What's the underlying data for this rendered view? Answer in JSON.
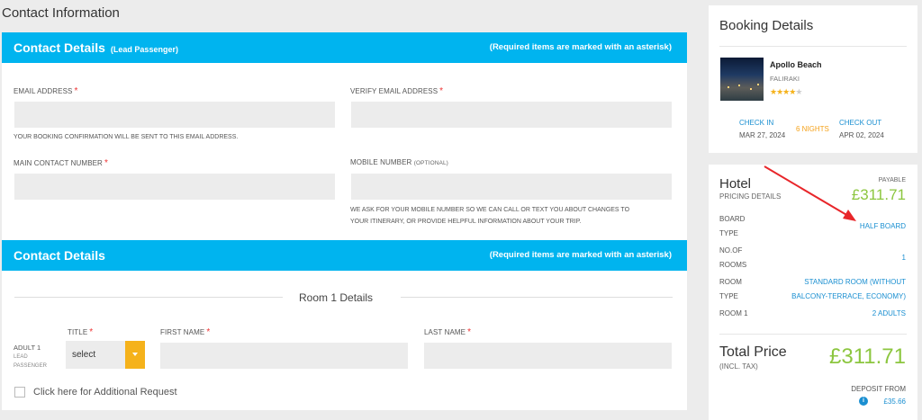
{
  "page_title": "Contact Information",
  "contact_section": {
    "title": "Contact Details",
    "subtitle": "(Lead Passenger)",
    "note": "(Required items are marked with an asterisk)",
    "email_label": "EMAIL ADDRESS",
    "email_value": "",
    "email_hint": "YOUR BOOKING CONFIRMATION WILL BE SENT TO THIS EMAIL ADDRESS.",
    "verify_email_label": "VERIFY EMAIL ADDRESS",
    "verify_email_value": "",
    "main_contact_label": "MAIN CONTACT NUMBER",
    "main_contact_value": "",
    "mobile_label": "MOBILE NUMBER",
    "mobile_optional": "(OPTIONAL)",
    "mobile_value": "",
    "mobile_hint_line1": "WE ASK FOR YOUR MOBILE NUMBER SO WE CAN CALL OR TEXT YOU ABOUT CHANGES TO",
    "mobile_hint_line2": "YOUR ITINERARY, OR PROVIDE HELPFUL INFORMATION ABOUT YOUR TRIP.",
    "required_mark": "*"
  },
  "room_section": {
    "title": "Contact Details",
    "note": "(Required items are marked with an asterisk)",
    "room_title": "Room 1 Details",
    "title_label": "TITLE",
    "first_name_label": "FIRST NAME",
    "last_name_label": "LAST NAME",
    "adult_label": "ADULT 1",
    "lead_line1": "LEAD",
    "lead_line2": "PASSENGER",
    "title_select_value": "select",
    "first_name_value": "",
    "last_name_value": "",
    "additional_request_label": "Click here for Additional Request"
  },
  "booking": {
    "title": "Booking Details",
    "hotel_name": "Apollo Beach",
    "hotel_location": "FALIRAKI",
    "rating_of_5": 4,
    "star_glyph": "★",
    "check_in_label": "CHECK IN",
    "check_in_date": "MAR 27, 2024",
    "nights": "6 NIGHTS",
    "check_out_label": "CHECK OUT",
    "check_out_date": "APR 02, 2024"
  },
  "pricing": {
    "title": "Hotel",
    "subtitle": "PRICING DETAILS",
    "payable_label": "PAYABLE",
    "payable_amount": "£311.71",
    "board_type_label_1": "BOARD",
    "board_type_label_2": "TYPE",
    "board_type_value": "HALF BOARD",
    "rooms_label_1": "NO.OF",
    "rooms_label_2": "ROOMS",
    "rooms_value": "1",
    "room_type_label_1": "ROOM",
    "room_type_label_2": "TYPE",
    "room_type_value_1": "STANDARD ROOM (WITHOUT",
    "room_type_value_2": "BALCONY-TERRACE, ECONOMY)",
    "room1_label": "ROOM 1",
    "room1_value": "2 ADULTS",
    "total_title": "Total Price",
    "total_sub": "(INCL. TAX)",
    "total_amount": "£311.71",
    "deposit_label": "DEPOSIT FROM",
    "deposit_amount": "£35.66",
    "info_glyph": "i"
  },
  "colors": {
    "header_bar": "#00b4ef",
    "price_green": "#8cc63f",
    "link_blue": "#1a8fd1",
    "select_button": "#f5b21b",
    "annotation_arrow": "#e8262a"
  }
}
